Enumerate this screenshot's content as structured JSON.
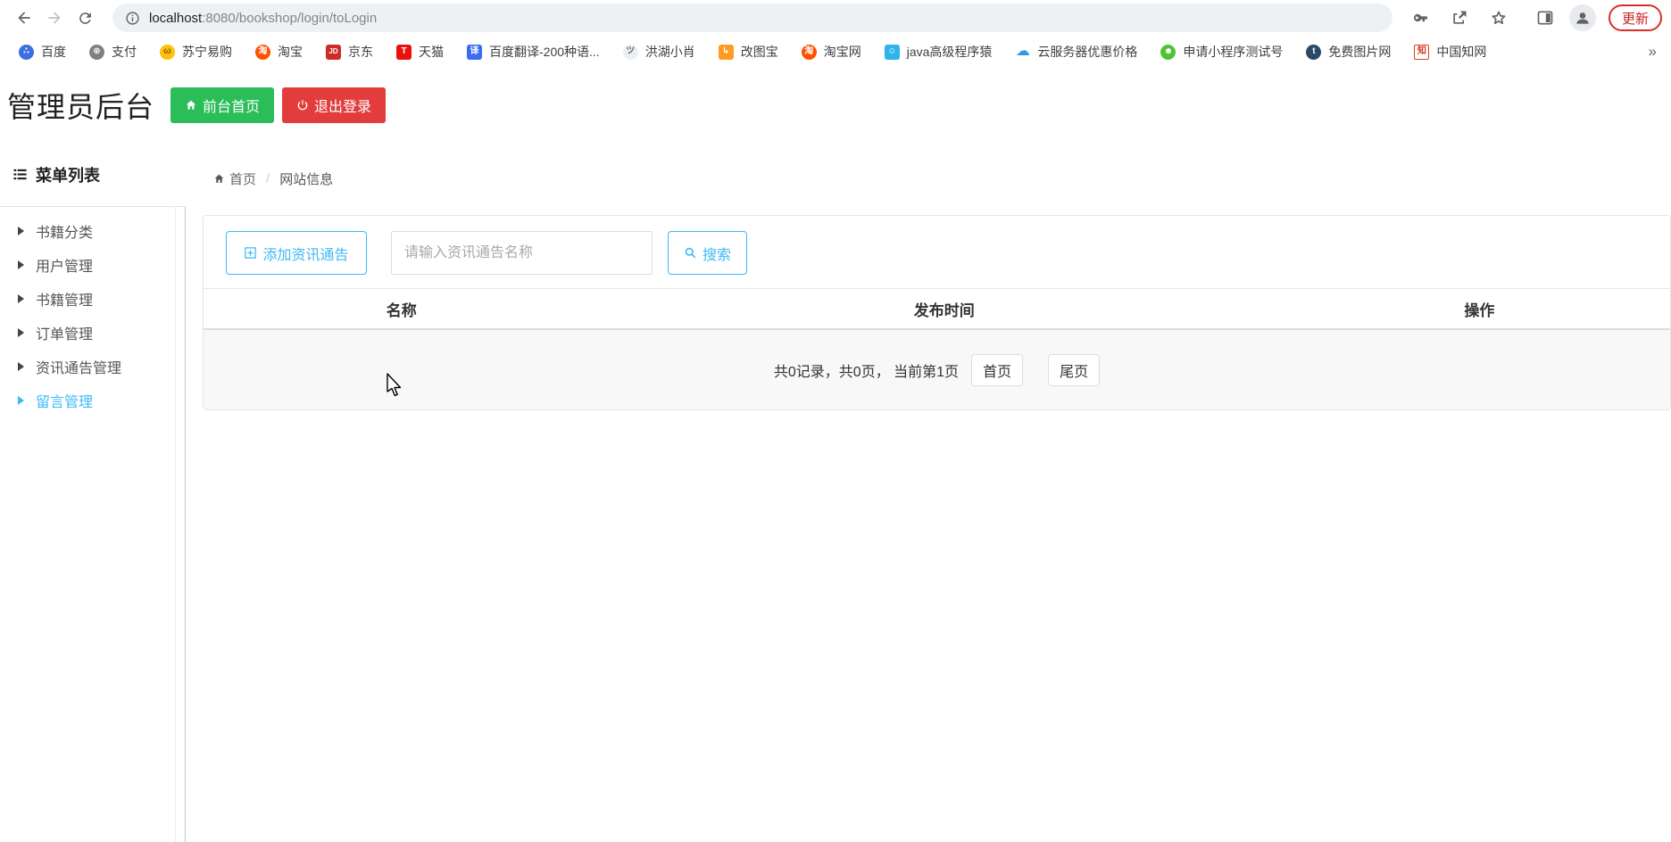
{
  "colors": {
    "accent_blue": "#3db9f5",
    "success_green": "#2abd58",
    "danger_red": "#e23c3c",
    "chrome_update_red": "#d93025",
    "sidebar_divider": "#b9ced6",
    "pagination_bg": "#f8f8f8"
  },
  "browser": {
    "url": {
      "host": "localhost",
      "rest": ":8080/bookshop/login/toLogin"
    },
    "update_button": "更新"
  },
  "bookmarks": {
    "overflow": "»",
    "items": [
      {
        "label": "百度",
        "icon": "baidu-paw-icon",
        "glyph": "∴",
        "bg": "#3a6fe0",
        "fg": "#ffffff",
        "radius": "50%"
      },
      {
        "label": "支付",
        "icon": "globe-icon",
        "glyph": "⊕",
        "bg": "#7d8085",
        "fg": "#ffffff",
        "radius": "50%"
      },
      {
        "label": "苏宁易购",
        "icon": "suning-lion-icon",
        "glyph": "ω",
        "bg": "#ffc10a",
        "fg": "#8a5a00",
        "radius": "50%"
      },
      {
        "label": "淘宝",
        "icon": "taobao-icon",
        "glyph": "淘",
        "bg": "#ff5000",
        "fg": "#ffffff",
        "radius": "50%"
      },
      {
        "label": "京东",
        "icon": "jd-icon",
        "glyph": "JD",
        "bg": "#ce2b29",
        "fg": "#ffffff",
        "radius": "3px",
        "fs": "8px"
      },
      {
        "label": "天猫",
        "icon": "tmall-icon",
        "glyph": "T",
        "bg": "#e8110e",
        "fg": "#ffffff",
        "radius": "3px"
      },
      {
        "label": "百度翻译-200种语...",
        "icon": "baidu-translate-icon",
        "glyph": "译",
        "bg": "#3b6cf0",
        "fg": "#ffffff",
        "radius": "3px"
      },
      {
        "label": "洪湖小肖",
        "icon": "bird-icon",
        "glyph": "ツ",
        "bg": "#eceff1",
        "fg": "#666666",
        "radius": "50%"
      },
      {
        "label": "改图宝",
        "icon": "gaitubao-icon",
        "glyph": "↳",
        "bg": "#ff9b21",
        "fg": "#ffffff",
        "radius": "3px"
      },
      {
        "label": "淘宝网",
        "icon": "taobao-icon",
        "glyph": "淘",
        "bg": "#ff5000",
        "fg": "#ffffff",
        "radius": "50%"
      },
      {
        "label": "java高级程序猿",
        "icon": "tv-icon",
        "glyph": "☺",
        "bg": "#2bb5ea",
        "fg": "#ffffff",
        "radius": "3px"
      },
      {
        "label": "云服务器优惠价格",
        "icon": "cloud-icon",
        "glyph": "☁",
        "bg": "transparent",
        "fg": "#2f9bdf",
        "radius": "0",
        "fs": "16px"
      },
      {
        "label": "申请小程序测试号",
        "icon": "wechat-icon",
        "glyph": "☻",
        "bg": "#4fc335",
        "fg": "#ffffff",
        "radius": "50%"
      },
      {
        "label": "免费图片网",
        "icon": "pixabay-t-icon",
        "glyph": "t",
        "bg": "#2b4a66",
        "fg": "#ffffff",
        "radius": "50%"
      },
      {
        "label": "中国知网",
        "icon": "cnki-icon",
        "glyph": "知",
        "bg": "#ffffff",
        "fg": "#d0361c",
        "radius": "2px",
        "border": "1px solid #e0401f"
      }
    ]
  },
  "header": {
    "title": "管理员后台",
    "front_home_button": "前台首页",
    "logout_button": "退出登录"
  },
  "sidebar": {
    "title": "菜单列表",
    "items": [
      {
        "label": "书籍分类"
      },
      {
        "label": "用户管理"
      },
      {
        "label": "书籍管理"
      },
      {
        "label": "订单管理"
      },
      {
        "label": "资讯通告管理"
      },
      {
        "label": "留言管理",
        "active": true
      }
    ]
  },
  "breadcrumb": {
    "home": "首页",
    "separator": "/",
    "current": "网站信息"
  },
  "toolbar": {
    "add_button": "添加资讯通告",
    "search_placeholder": "请输入资讯通告名称",
    "search_button": "搜索"
  },
  "table": {
    "columns": [
      {
        "label": "名称"
      },
      {
        "label": "发布时间"
      },
      {
        "label": "操作"
      }
    ]
  },
  "pagination": {
    "summary": "共0记录，共0页， 当前第1页",
    "first_button": "首页",
    "last_button": "尾页"
  }
}
